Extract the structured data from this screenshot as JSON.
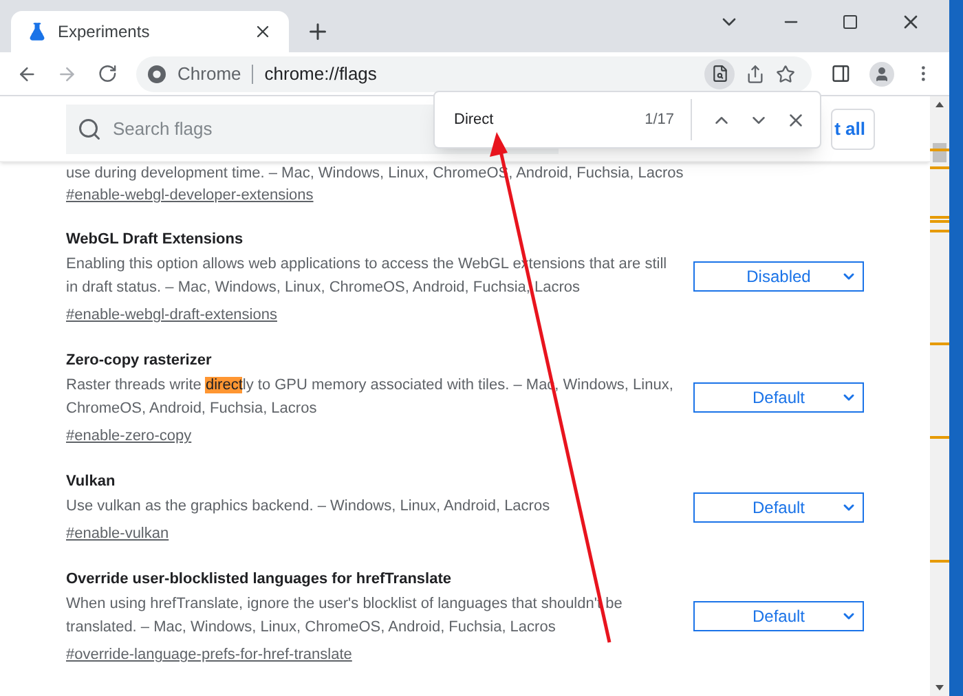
{
  "tab": {
    "title": "Experiments",
    "selected": true
  },
  "address": {
    "site": "Chrome",
    "url": "chrome://flags"
  },
  "search": {
    "placeholder": "Search flags"
  },
  "reset_button": "t all",
  "find_bar": {
    "query": "Direct",
    "count": "1/17"
  },
  "partial_line": "use during development time. – Mac, Windows, Linux, ChromeOS, Android, Fuchsia, Lacros",
  "partial_link": "#enable-webgl-developer-extensions",
  "flags": [
    {
      "title": "WebGL Draft Extensions",
      "description": "Enabling this option allows web applications to access the WebGL extensions that are still in draft status. – Mac, Windows, Linux, ChromeOS, Android, Fuchsia, Lacros",
      "link": "#enable-webgl-draft-extensions",
      "value": "Disabled"
    },
    {
      "title": "Zero-copy rasterizer",
      "description": "Raster threads write ",
      "match": "direct",
      "description_after": "ly to GPU memory associated with tiles. – Mac, Windows, Linux, ChromeOS, Android, Fuchsia, Lacros",
      "link": "#enable-zero-copy",
      "value": "Default"
    },
    {
      "title": "Vulkan",
      "description": "Use vulkan as the graphics backend. – Windows, Linux, Android, Lacros",
      "link": "#enable-vulkan",
      "value": "Default"
    },
    {
      "title": "Override user-blocklisted languages for hrefTranslate",
      "description": "When using hrefTranslate, ignore the user's blocklist of languages that shouldn't be translated. – Mac, Windows, Linux, ChromeOS, Android, Fuchsia, Lacros",
      "link": "#override-language-prefs-for-href-translate",
      "value": "Default"
    }
  ]
}
